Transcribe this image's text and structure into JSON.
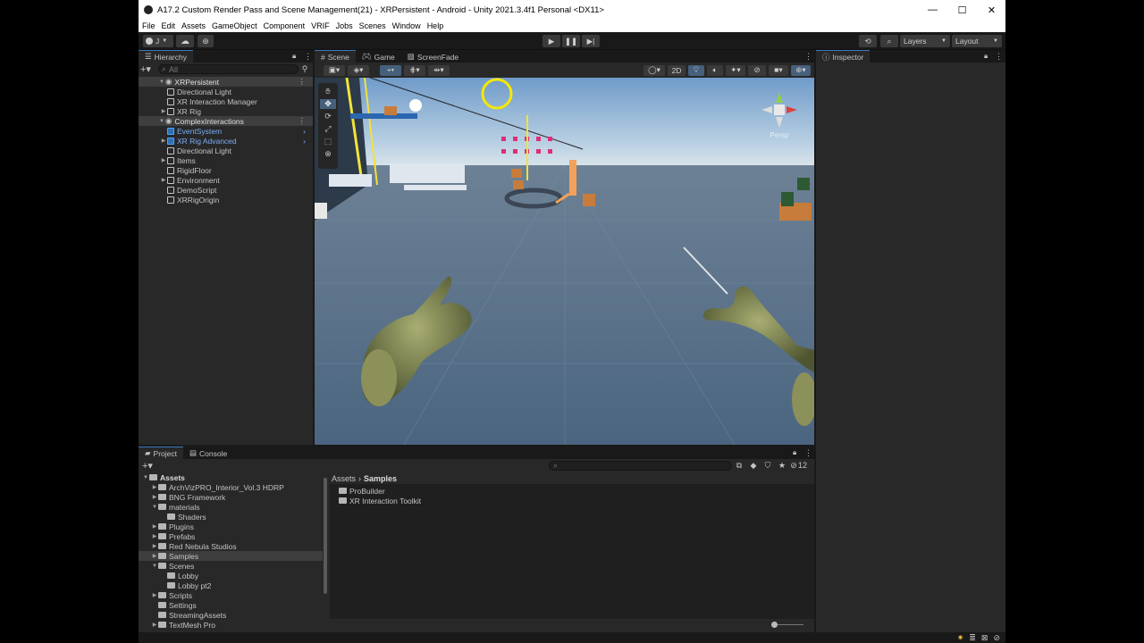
{
  "window": {
    "title": "A17.2 Custom Render Pass and Scene Management(21) - XRPersistent - Android - Unity 2021.3.4f1 Personal <DX11>",
    "controls": [
      "—",
      "☐",
      "✕"
    ]
  },
  "menu": [
    "File",
    "Edit",
    "Assets",
    "GameObject",
    "Component",
    "VRIF",
    "Jobs",
    "Scenes",
    "Window",
    "Help"
  ],
  "toolbar": {
    "account": "J",
    "layers": "Layers",
    "layout": "Layout"
  },
  "hierarchy": {
    "tab": "Hierarchy",
    "search_placeholder": "All",
    "items": [
      {
        "label": "XRPersistent",
        "indent": 0,
        "type": "scene"
      },
      {
        "label": "Directional Light",
        "indent": 1
      },
      {
        "label": "XR Interaction Manager",
        "indent": 1
      },
      {
        "label": "XR Rig",
        "indent": 1,
        "arrow": true
      },
      {
        "label": "ComplexInteractions",
        "indent": 0,
        "type": "scene"
      },
      {
        "label": "EventSystem",
        "indent": 1,
        "blue": true
      },
      {
        "label": "XR Rig Advanced",
        "indent": 1,
        "blue": true,
        "arrow": true
      },
      {
        "label": "Directional Light",
        "indent": 1
      },
      {
        "label": "Items",
        "indent": 1,
        "arrow": true
      },
      {
        "label": "RigidFloor",
        "indent": 1
      },
      {
        "label": "Environment",
        "indent": 1,
        "arrow": true
      },
      {
        "label": "DemoScript",
        "indent": 1
      },
      {
        "label": "XRRigOrigin",
        "indent": 1
      }
    ]
  },
  "scene_tabs": [
    "Scene",
    "Game",
    "ScreenFade"
  ],
  "scene_toolbar": {
    "mode_2d": "2D"
  },
  "gizmo": {
    "label": "Persp"
  },
  "inspector": {
    "tab": "Inspector"
  },
  "project": {
    "tabs": [
      "Project",
      "Console"
    ],
    "hidden_count": "12",
    "breadcrumb": [
      "Assets",
      "Samples"
    ],
    "tree": [
      {
        "label": "Assets",
        "indent": 0,
        "bold": true
      },
      {
        "label": "ArchVizPRO_Interior_Vol.3 HDRP",
        "indent": 1
      },
      {
        "label": "BNG Framework",
        "indent": 1
      },
      {
        "label": "materials",
        "indent": 1
      },
      {
        "label": "Shaders",
        "indent": 2
      },
      {
        "label": "Plugins",
        "indent": 1
      },
      {
        "label": "Prefabs",
        "indent": 1
      },
      {
        "label": "Red Nebula Studios",
        "indent": 1
      },
      {
        "label": "Samples",
        "indent": 1
      },
      {
        "label": "Scenes",
        "indent": 1
      },
      {
        "label": "Lobby",
        "indent": 2
      },
      {
        "label": "Lobby pt2",
        "indent": 2
      },
      {
        "label": "Scripts",
        "indent": 1
      },
      {
        "label": "Settings",
        "indent": 1
      },
      {
        "label": "StreamingAssets",
        "indent": 1
      },
      {
        "label": "TextMesh Pro",
        "indent": 1
      }
    ],
    "content": [
      "ProBuilder",
      "XR Interaction Toolkit"
    ]
  }
}
